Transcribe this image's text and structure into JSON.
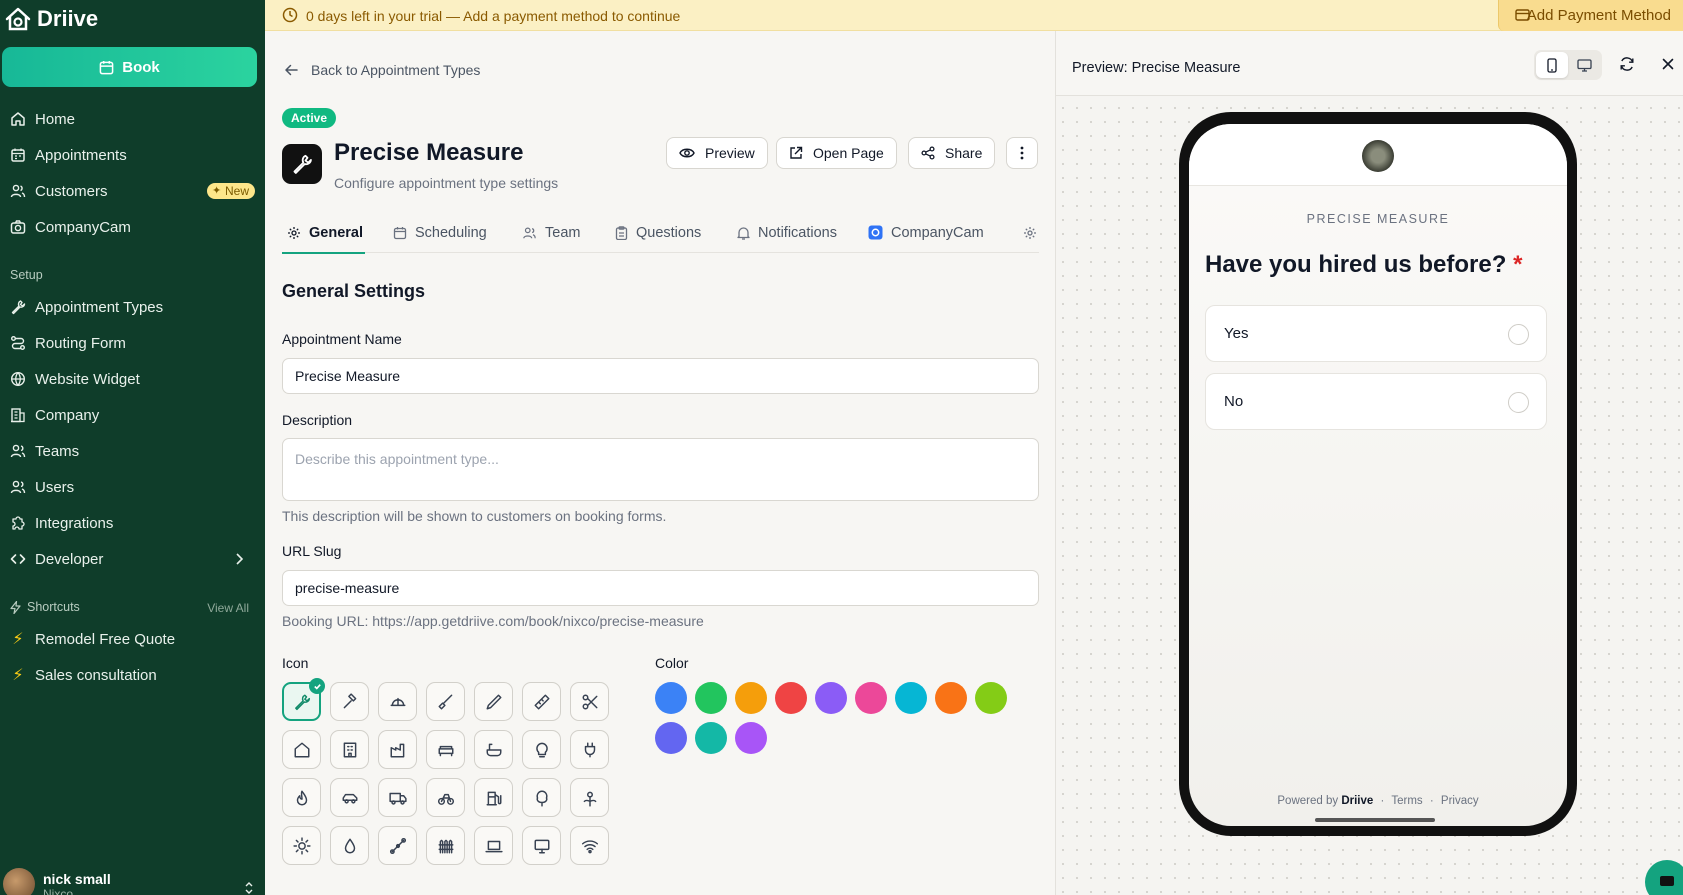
{
  "sidebar": {
    "brand": "Driive",
    "book_label": "Book",
    "nav": [
      {
        "label": "Home",
        "icon": "home-icon"
      },
      {
        "label": "Appointments",
        "icon": "calendar-icon"
      },
      {
        "label": "Customers",
        "icon": "users-icon",
        "badge": "New"
      },
      {
        "label": "CompanyCam",
        "icon": "camera-icon"
      }
    ],
    "setup_label": "Setup",
    "setup": [
      {
        "label": "Appointment Types",
        "icon": "wrench-icon"
      },
      {
        "label": "Routing Form",
        "icon": "route-icon"
      },
      {
        "label": "Website Widget",
        "icon": "globe-icon"
      },
      {
        "label": "Company",
        "icon": "building-icon"
      },
      {
        "label": "Teams",
        "icon": "team-icon"
      },
      {
        "label": "Users",
        "icon": "users-icon"
      },
      {
        "label": "Integrations",
        "icon": "puzzle-icon"
      },
      {
        "label": "Developer",
        "icon": "code-icon"
      }
    ],
    "shortcuts_label": "Shortcuts",
    "view_all": "View All",
    "shortcuts": [
      {
        "label": "Remodel Free Quote"
      },
      {
        "label": "Sales consultation"
      }
    ],
    "user": {
      "name": "nick small",
      "org": "Nixco"
    }
  },
  "banner": {
    "text": "0 days left in your trial — Add a payment method to continue",
    "button": "Add Payment Method"
  },
  "main": {
    "back_label": "Back to Appointment Types",
    "status": "Active",
    "title": "Precise Measure",
    "subtitle": "Configure appointment type settings",
    "actions": {
      "preview": "Preview",
      "open_page": "Open Page",
      "share": "Share"
    },
    "tabs": [
      "General",
      "Scheduling",
      "Team",
      "Questions",
      "Notifications",
      "CompanyCam"
    ],
    "section_title": "General Settings",
    "name_label": "Appointment Name",
    "name_value": "Precise Measure",
    "description_label": "Description",
    "description_placeholder": "Describe this appointment type...",
    "description_help": "This description will be shown to customers on booking forms.",
    "slug_label": "URL Slug",
    "slug_value": "precise-measure",
    "booking_url": "Booking URL: https://app.getdriive.com/book/nixco/precise-measure",
    "icon_label": "Icon",
    "color_label": "Color",
    "icons": [
      "wrench-icon",
      "hammer-icon",
      "hardhat-icon",
      "paint-brush-icon",
      "pen-icon",
      "ruler-icon",
      "scissors-icon",
      "home-icon",
      "office-building-icon",
      "factory-icon",
      "sofa-icon",
      "bathtub-icon",
      "lightbulb-icon",
      "plug-icon",
      "flame-icon",
      "car-icon",
      "truck-icon",
      "bicycle-icon",
      "fuel-icon",
      "tree-icon",
      "flower-icon",
      "sun-icon",
      "droplet-icon",
      "pipe-icon",
      "fence-icon",
      "laptop-icon",
      "monitor-icon",
      "wifi-icon"
    ],
    "colors": [
      "#3b82f6",
      "#22c55e",
      "#f59e0b",
      "#ef4444",
      "#8b5cf6",
      "#ec4899",
      "#06b6d4",
      "#f97316",
      "#84cc16",
      "#6366f1",
      "#14b8a6",
      "#a855f7"
    ]
  },
  "preview": {
    "title": "Preview: Precise Measure",
    "kicker": "PRECISE MEASURE",
    "question": "Have you hired us before?",
    "required_mark": "*",
    "options": [
      "Yes",
      "No"
    ],
    "footer_prefix": "Powered by",
    "footer_brand": "Driive",
    "footer_sep": "·",
    "footer_terms": "Terms",
    "footer_privacy": "Privacy"
  }
}
